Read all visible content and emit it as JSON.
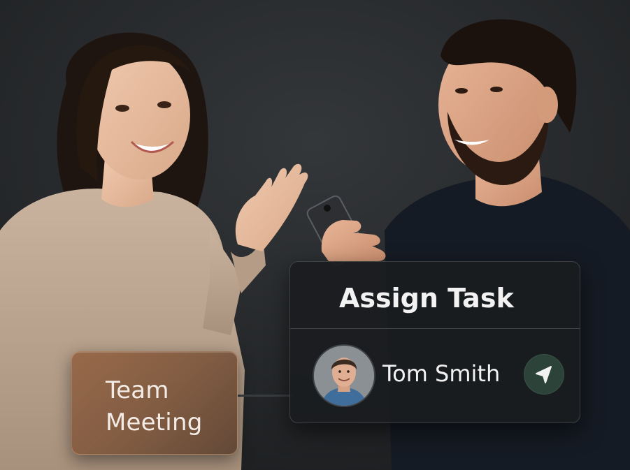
{
  "team_card": {
    "line1": "Team",
    "line2": "Meeting"
  },
  "assign_card": {
    "title": "Assign Task",
    "assignee": {
      "name": "Tom Smith",
      "avatar_icon": "person-avatar"
    },
    "send_icon": "navigation-arrow-icon"
  },
  "colors": {
    "background": "#262829",
    "team_card": "#96664a",
    "assign_card": "#1a1c1f",
    "send_button": "#2b4338",
    "text": "#f2f2f2"
  }
}
